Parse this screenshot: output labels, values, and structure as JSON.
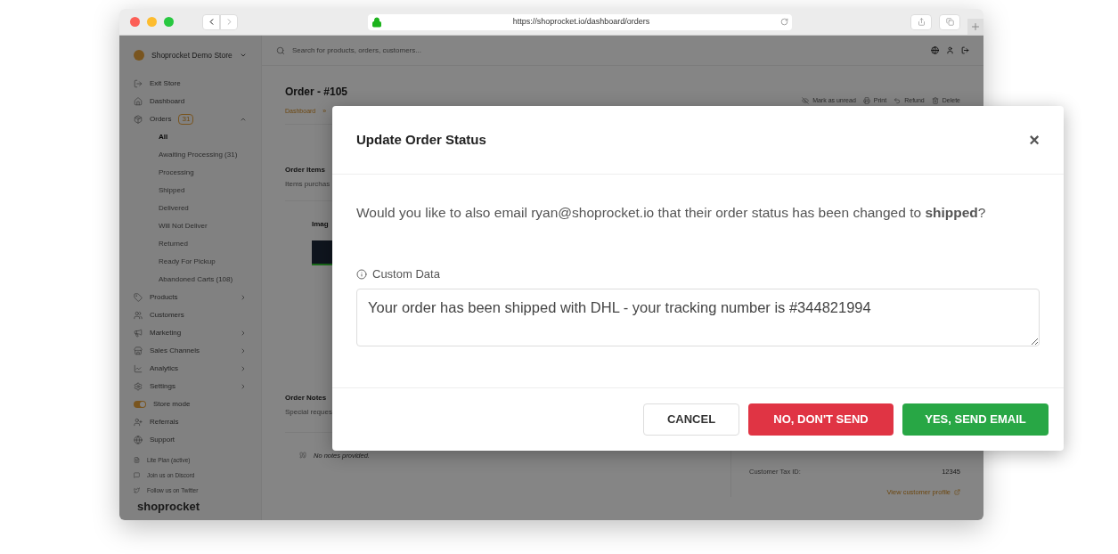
{
  "browser": {
    "url": "https://shoprocket.io/dashboard/orders"
  },
  "sidebar": {
    "store_name": "Shoprocket Demo Store",
    "items": [
      {
        "kind": "nav",
        "label": "Exit Store"
      },
      {
        "kind": "nav",
        "label": "Dashboard"
      },
      {
        "kind": "nav",
        "label": "Orders",
        "badge": "31",
        "expanded": true,
        "children": [
          {
            "label": "All",
            "selected": true
          },
          {
            "label": "Awaiting Processing (31)",
            "selected": false
          },
          {
            "label": "Processing",
            "selected": false
          },
          {
            "label": "Shipped",
            "selected": false
          },
          {
            "label": "Delivered",
            "selected": false
          },
          {
            "label": "Will Not Deliver",
            "selected": false
          },
          {
            "label": "Returned",
            "selected": false
          },
          {
            "label": "Ready For Pickup",
            "selected": false
          },
          {
            "label": "Abandoned Carts (108)",
            "selected": false
          }
        ]
      },
      {
        "kind": "nav",
        "label": "Products",
        "expanded": false
      },
      {
        "kind": "nav",
        "label": "Customers"
      },
      {
        "kind": "nav",
        "label": "Marketing",
        "expanded": false
      },
      {
        "kind": "nav",
        "label": "Sales Channels",
        "expanded": false
      },
      {
        "kind": "nav",
        "label": "Analytics",
        "expanded": false
      },
      {
        "kind": "nav",
        "label": "Settings",
        "expanded": false
      },
      {
        "kind": "toggle",
        "label": "Store mode",
        "on": true
      },
      {
        "kind": "nav",
        "label": "Referrals"
      },
      {
        "kind": "nav",
        "label": "Support"
      }
    ],
    "footer_links": [
      "Lite Plan (active)",
      "Join us on Discord",
      "Follow us on Twitter"
    ],
    "logo": "shoprocket"
  },
  "topbar": {
    "search": {
      "placeholder": "Search for products, orders, customers..."
    }
  },
  "order": {
    "title": "Order - #105",
    "breadcrumb": [
      "Dashboard",
      "»"
    ],
    "actions": [
      "Mark as unread",
      "Print",
      "Refund",
      "Delete"
    ],
    "items_section": {
      "title": "Order Items",
      "subtitle": "Items purchas",
      "column": "Imag"
    },
    "notes_section": {
      "title": "Order Notes",
      "subtitle": "Special reques",
      "empty": "No notes provided."
    },
    "customer": {
      "tax_label": "Customer Tax ID:",
      "tax_value": "12345",
      "profile_link": "View customer profile"
    }
  },
  "modal": {
    "title": "Update Order Status",
    "close": "×",
    "message": "Would you like to also email ryan@shoprocket.io that their order status has been changed to **shipped**?",
    "field_label": "Custom Data",
    "field_value": "Your order has been shipped with DHL - your tracking number is #344821994",
    "buttons": [
      {
        "kind": "secondary",
        "label": "CANCEL"
      },
      {
        "kind": "danger",
        "label": "NO, DON'T SEND"
      },
      {
        "kind": "success",
        "label": "YES, SEND EMAIL"
      }
    ]
  }
}
